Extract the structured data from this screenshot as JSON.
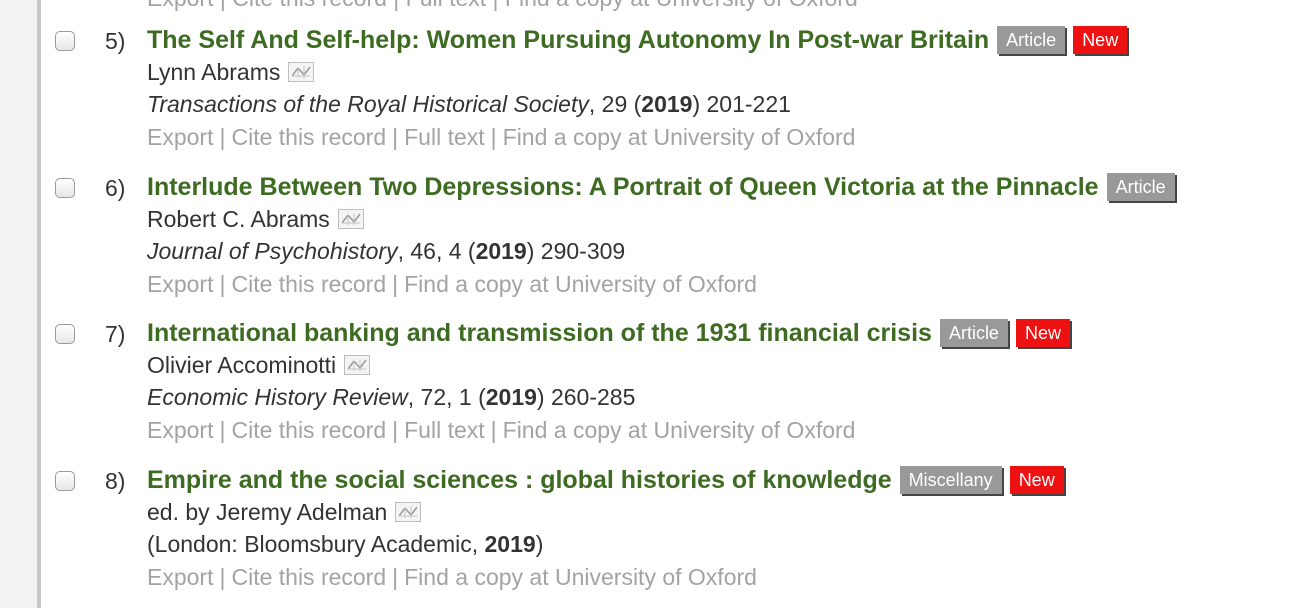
{
  "top_partial": "Export | Cite this record | Full text | Find a copy at University of Oxford",
  "records": [
    {
      "number": "5)",
      "title": "The Self And Self-help: Women Pursuing Autonomy In Post-war Britain",
      "badges": [
        "Article",
        "New"
      ],
      "author": "Lynn Abrams",
      "source_prefix": "",
      "journal": "Transactions of the Royal Historical Society",
      "source_mid": ", 29 (",
      "year": "2019",
      "source_suffix": ") 201-221",
      "actions": [
        "Export",
        "Cite this record",
        "Full text",
        "Find a copy at University of Oxford"
      ]
    },
    {
      "number": "6)",
      "title": "Interlude Between Two Depressions: A Portrait of Queen Victoria at the Pinnacle",
      "badges": [
        "Article"
      ],
      "author": "Robert C. Abrams",
      "source_prefix": "",
      "journal": "Journal of Psychohistory",
      "source_mid": ", 46, 4 (",
      "year": "2019",
      "source_suffix": ") 290-309",
      "actions": [
        "Export",
        "Cite this record",
        "Find a copy at University of Oxford"
      ]
    },
    {
      "number": "7)",
      "title": "International banking and transmission of the 1931 financial crisis",
      "badges": [
        "Article",
        "New"
      ],
      "author": "Olivier Accominotti",
      "source_prefix": "",
      "journal": "Economic History Review",
      "source_mid": ", 72, 1 (",
      "year": "2019",
      "source_suffix": ") 260-285",
      "actions": [
        "Export",
        "Cite this record",
        "Full text",
        "Find a copy at University of Oxford"
      ]
    },
    {
      "number": "8)",
      "title": "Empire and the social sciences : global histories of knowledge",
      "badges": [
        "Miscellany",
        "New"
      ],
      "author": "ed. by Jeremy Adelman",
      "source_prefix": "(London: Bloomsbury Academic, ",
      "journal": "",
      "source_mid": "",
      "year": "2019",
      "source_suffix": ")",
      "actions": [
        "Export",
        "Cite this record",
        "Find a copy at University of Oxford"
      ]
    }
  ],
  "colors": {
    "title": "#3d6b21",
    "badge_type": "#999999",
    "badge_new": "#ee1111",
    "action_text": "#a3a3a3"
  },
  "icons": {
    "author_icon": "author-network-icon"
  }
}
